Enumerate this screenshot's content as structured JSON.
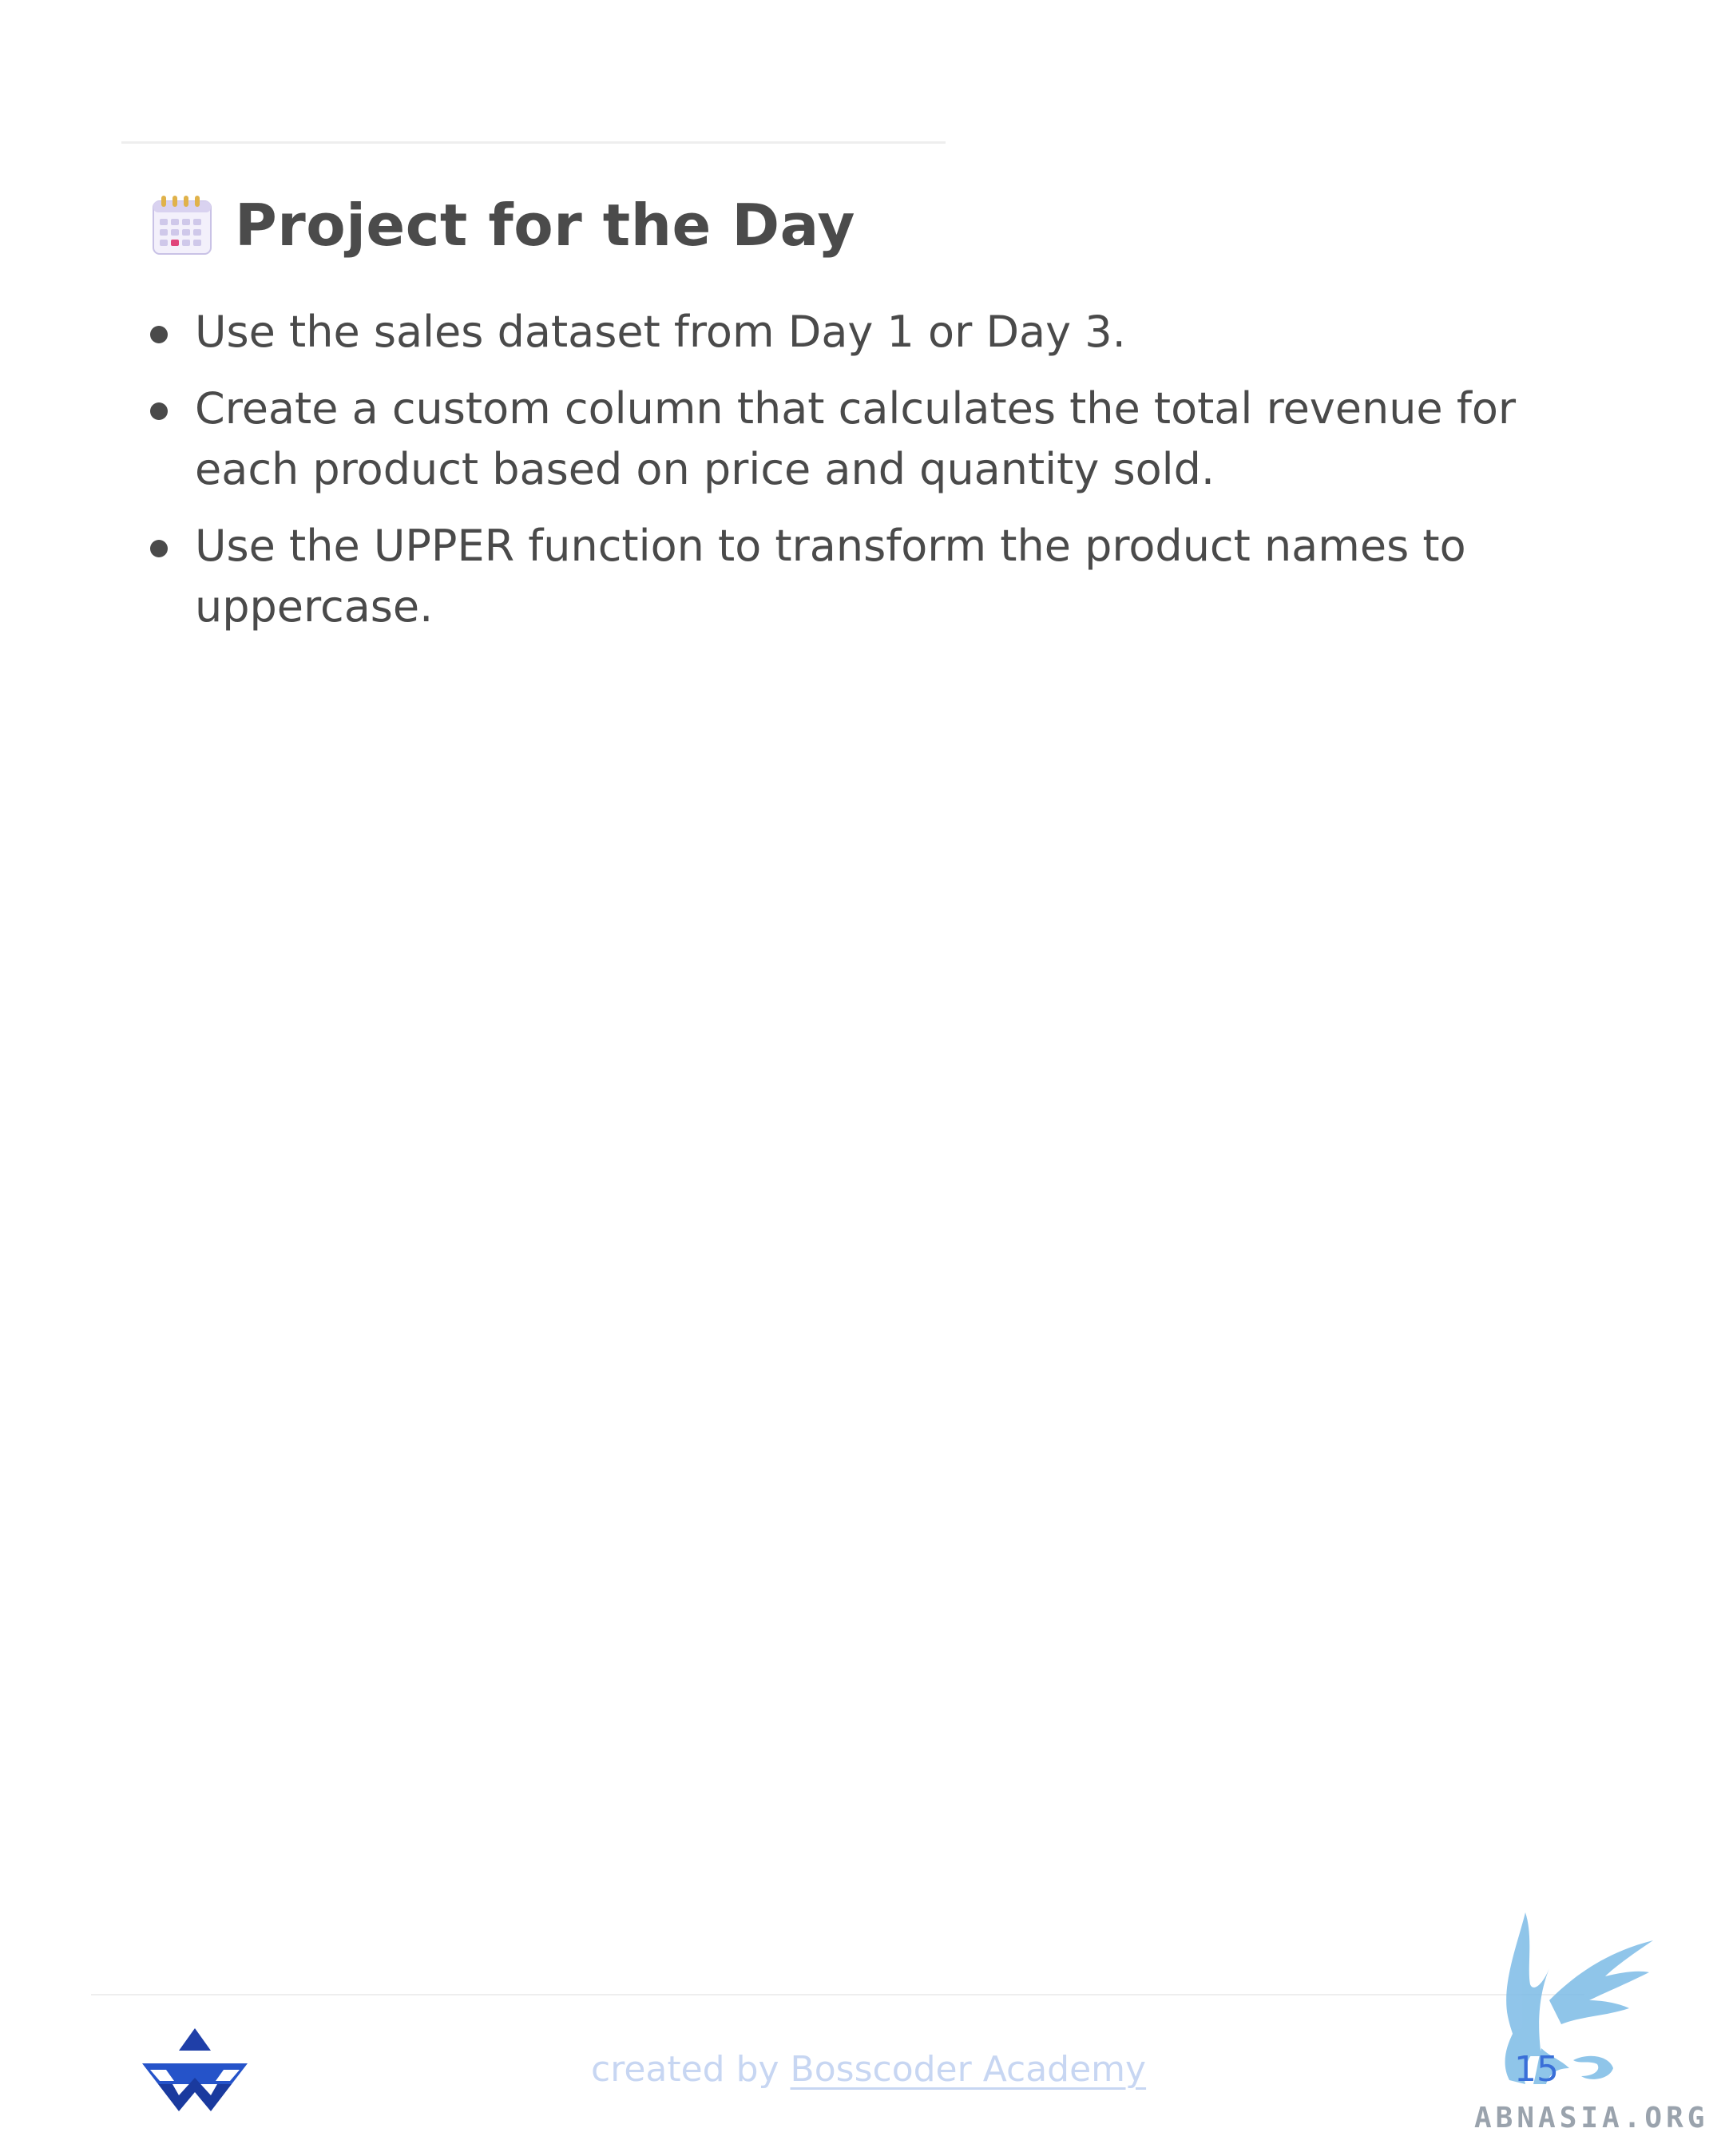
{
  "heading": {
    "icon": "calendar-icon",
    "title": "Project for the Day"
  },
  "bullets": [
    "Use the sales dataset from Day 1 or Day 3.",
    "Create a custom column that calculates the total revenue for each product based on price and quantity sold.",
    "Use the UPPER function to transform the product names to uppercase."
  ],
  "footer": {
    "logo": "bosscoder-logo",
    "prefix": "created by ",
    "link_text": "Bosscoder Academy",
    "page_number": "15"
  },
  "watermark": {
    "icon": "griffin-icon",
    "text": "ABNASIA.ORG"
  },
  "colors": {
    "text": "#4a4a4a",
    "footer_text": "#c7d6f2",
    "page_number": "#3a6fd8",
    "logo_blue": "#2553c9",
    "watermark_blue": "#7cbbe6"
  }
}
